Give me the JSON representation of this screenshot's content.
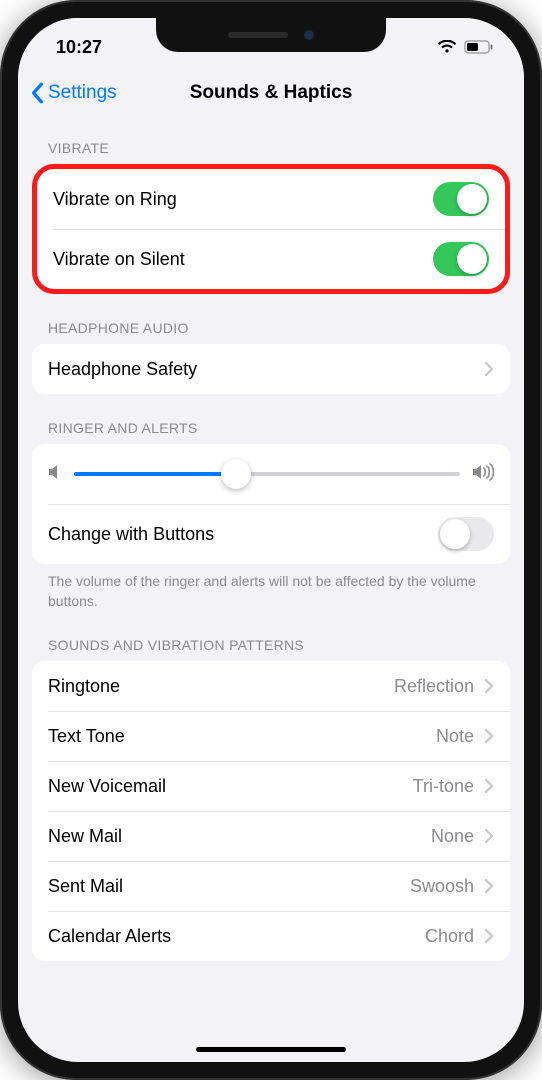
{
  "status": {
    "time": "10:27"
  },
  "nav": {
    "back": "Settings",
    "title": "Sounds & Haptics"
  },
  "sections": {
    "vibrate": {
      "header": "VIBRATE",
      "ring": {
        "label": "Vibrate on Ring",
        "on": true
      },
      "silent": {
        "label": "Vibrate on Silent",
        "on": true
      }
    },
    "headphone": {
      "header": "HEADPHONE AUDIO",
      "safety": {
        "label": "Headphone Safety"
      }
    },
    "ringer": {
      "header": "RINGER AND ALERTS",
      "volume_percent": 42,
      "change_buttons": {
        "label": "Change with Buttons",
        "on": false
      },
      "note": "The volume of the ringer and alerts will not be affected by the volume buttons."
    },
    "patterns": {
      "header": "SOUNDS AND VIBRATION PATTERNS",
      "items": [
        {
          "label": "Ringtone",
          "value": "Reflection"
        },
        {
          "label": "Text Tone",
          "value": "Note"
        },
        {
          "label": "New Voicemail",
          "value": "Tri-tone"
        },
        {
          "label": "New Mail",
          "value": "None"
        },
        {
          "label": "Sent Mail",
          "value": "Swoosh"
        },
        {
          "label": "Calendar Alerts",
          "value": "Chord"
        }
      ]
    }
  }
}
